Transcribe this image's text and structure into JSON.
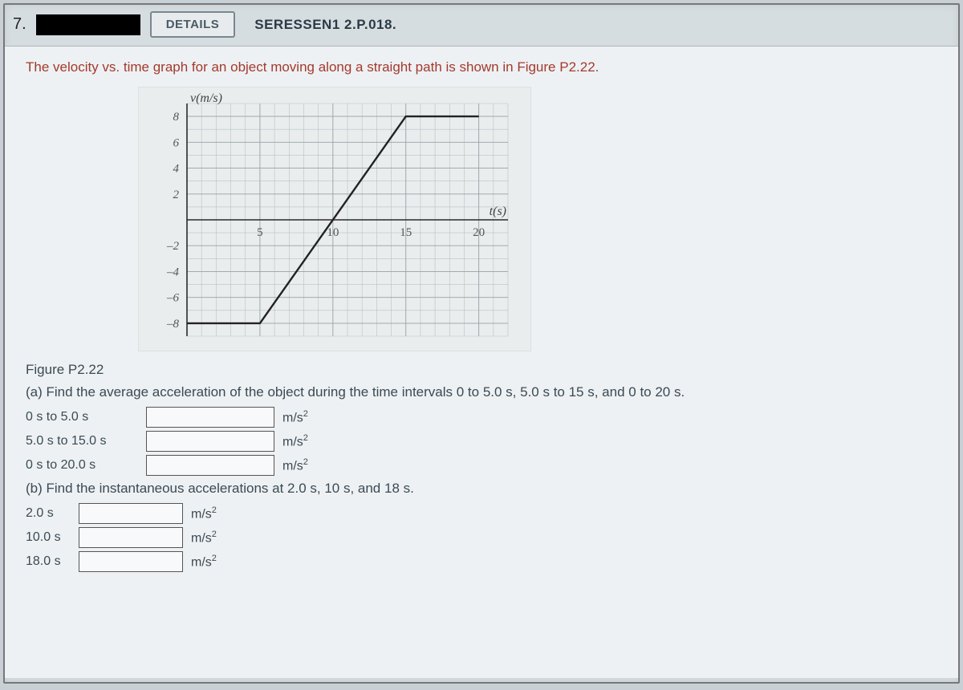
{
  "question_number": "7.",
  "details_label": "DETAILS",
  "source_code": "SERESSEN1 2.P.018.",
  "prompt": "The velocity vs. time graph for an object moving along a straight path is shown in Figure P2.22.",
  "figure_caption": "Figure P2.22",
  "part_a": "(a) Find the average acceleration of the object during the time intervals 0 to 5.0 s, 5.0 s to 15 s, and 0 to 20 s.",
  "part_b": "(b) Find the instantaneous accelerations at 2.0 s, 10 s, and 18 s.",
  "unit": "m/s",
  "unit_exp": "2",
  "rows_a": [
    {
      "label": "0 s to 5.0 s"
    },
    {
      "label": "5.0 s to 15.0 s"
    },
    {
      "label": "0 s to 20.0 s"
    }
  ],
  "rows_b": [
    {
      "label": "2.0 s"
    },
    {
      "label": "10.0 s"
    },
    {
      "label": "18.0 s"
    }
  ],
  "chart_data": {
    "type": "line",
    "title": "",
    "xlabel": "t(s)",
    "ylabel": "v(m/s)",
    "xlim": [
      0,
      22
    ],
    "ylim": [
      -9,
      9
    ],
    "x_ticks": [
      5,
      10,
      15,
      20
    ],
    "y_ticks": [
      -8,
      -6,
      -4,
      -2,
      2,
      4,
      6,
      8
    ],
    "series": [
      {
        "name": "velocity",
        "points": [
          {
            "t": 0,
            "v": -8
          },
          {
            "t": 5,
            "v": -8
          },
          {
            "t": 15,
            "v": 8
          },
          {
            "t": 20,
            "v": 8
          }
        ]
      }
    ]
  }
}
